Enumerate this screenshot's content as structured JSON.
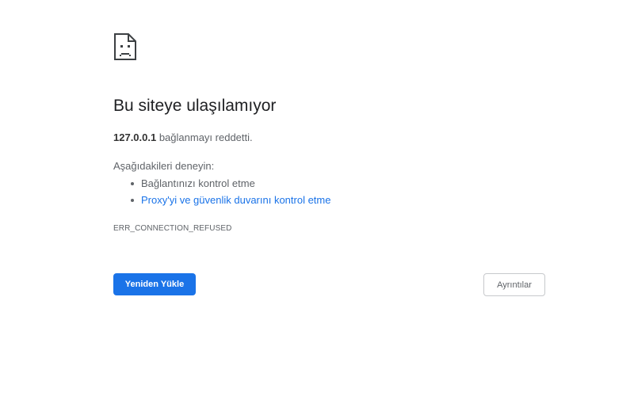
{
  "error_icon": "sad-page-icon",
  "title": "Bu siteye ulaşılamıyor",
  "subtitle": {
    "host": "127.0.0.1",
    "message": " bağlanmayı reddetti."
  },
  "try_heading": "Aşağıdakileri deneyin:",
  "suggestions": [
    {
      "label": "Bağlantınızı kontrol etme",
      "link": false
    },
    {
      "label": "Proxy'yi ve güvenlik duvarını kontrol etme",
      "link": true
    }
  ],
  "error_code": "ERR_CONNECTION_REFUSED",
  "buttons": {
    "reload_label": "Yeniden Yükle",
    "details_label": "Ayrıntılar"
  },
  "colors": {
    "accent": "#1a73e8",
    "text_secondary": "#5f6368",
    "title": "#202124"
  }
}
